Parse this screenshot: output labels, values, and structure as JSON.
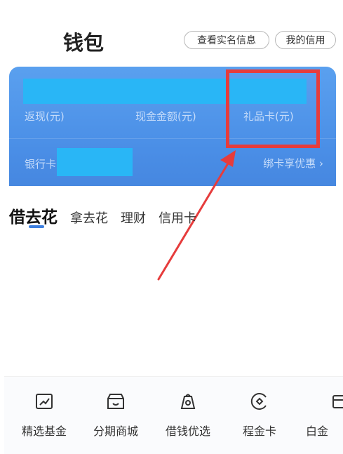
{
  "header": {
    "title": "钱包",
    "realname_button": "查看实名信息",
    "credit_button": "我的信用"
  },
  "card": {
    "cashback_label": "返现(元)",
    "cash_amount_label": "现金金额(元)",
    "giftcard_label": "礼品卡(元)",
    "bank_label": "银行卡",
    "bind_card_link": "绑卡享优惠 ›"
  },
  "tabs": [
    {
      "label": "借去花",
      "active": true
    },
    {
      "label": "拿去花",
      "active": false
    },
    {
      "label": "理财",
      "active": false
    },
    {
      "label": "信用卡",
      "active": false
    }
  ],
  "shortcuts": [
    {
      "label": "精选基金",
      "icon": "chart-frame-icon"
    },
    {
      "label": "分期商城",
      "icon": "storefront-icon"
    },
    {
      "label": "借钱优选",
      "icon": "money-bag-icon"
    },
    {
      "label": "程金卡",
      "icon": "coin-circle-icon"
    },
    {
      "label": "白金",
      "icon": "wallet-card-icon"
    }
  ],
  "colors": {
    "card_blue": "#4a8ee6",
    "mask_blue": "#29b6f6",
    "highlight_red": "#e63c3c",
    "tab_indicator": "#3d7fe0"
  }
}
